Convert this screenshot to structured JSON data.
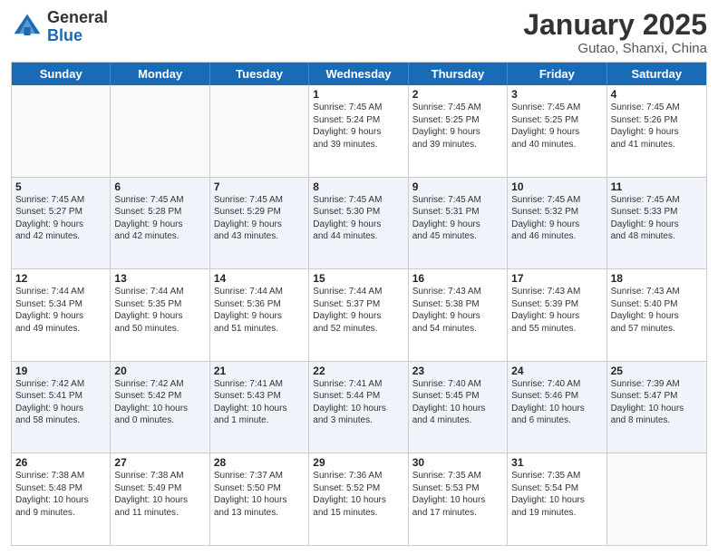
{
  "logo": {
    "general": "General",
    "blue": "Blue"
  },
  "title": "January 2025",
  "subtitle": "Gutao, Shanxi, China",
  "header_days": [
    "Sunday",
    "Monday",
    "Tuesday",
    "Wednesday",
    "Thursday",
    "Friday",
    "Saturday"
  ],
  "rows": [
    {
      "alt": false,
      "cells": [
        {
          "empty": true,
          "day": "",
          "detail": ""
        },
        {
          "empty": true,
          "day": "",
          "detail": ""
        },
        {
          "empty": true,
          "day": "",
          "detail": ""
        },
        {
          "empty": false,
          "day": "1",
          "detail": "Sunrise: 7:45 AM\nSunset: 5:24 PM\nDaylight: 9 hours\nand 39 minutes."
        },
        {
          "empty": false,
          "day": "2",
          "detail": "Sunrise: 7:45 AM\nSunset: 5:25 PM\nDaylight: 9 hours\nand 39 minutes."
        },
        {
          "empty": false,
          "day": "3",
          "detail": "Sunrise: 7:45 AM\nSunset: 5:25 PM\nDaylight: 9 hours\nand 40 minutes."
        },
        {
          "empty": false,
          "day": "4",
          "detail": "Sunrise: 7:45 AM\nSunset: 5:26 PM\nDaylight: 9 hours\nand 41 minutes."
        }
      ]
    },
    {
      "alt": true,
      "cells": [
        {
          "empty": false,
          "day": "5",
          "detail": "Sunrise: 7:45 AM\nSunset: 5:27 PM\nDaylight: 9 hours\nand 42 minutes."
        },
        {
          "empty": false,
          "day": "6",
          "detail": "Sunrise: 7:45 AM\nSunset: 5:28 PM\nDaylight: 9 hours\nand 42 minutes."
        },
        {
          "empty": false,
          "day": "7",
          "detail": "Sunrise: 7:45 AM\nSunset: 5:29 PM\nDaylight: 9 hours\nand 43 minutes."
        },
        {
          "empty": false,
          "day": "8",
          "detail": "Sunrise: 7:45 AM\nSunset: 5:30 PM\nDaylight: 9 hours\nand 44 minutes."
        },
        {
          "empty": false,
          "day": "9",
          "detail": "Sunrise: 7:45 AM\nSunset: 5:31 PM\nDaylight: 9 hours\nand 45 minutes."
        },
        {
          "empty": false,
          "day": "10",
          "detail": "Sunrise: 7:45 AM\nSunset: 5:32 PM\nDaylight: 9 hours\nand 46 minutes."
        },
        {
          "empty": false,
          "day": "11",
          "detail": "Sunrise: 7:45 AM\nSunset: 5:33 PM\nDaylight: 9 hours\nand 48 minutes."
        }
      ]
    },
    {
      "alt": false,
      "cells": [
        {
          "empty": false,
          "day": "12",
          "detail": "Sunrise: 7:44 AM\nSunset: 5:34 PM\nDaylight: 9 hours\nand 49 minutes."
        },
        {
          "empty": false,
          "day": "13",
          "detail": "Sunrise: 7:44 AM\nSunset: 5:35 PM\nDaylight: 9 hours\nand 50 minutes."
        },
        {
          "empty": false,
          "day": "14",
          "detail": "Sunrise: 7:44 AM\nSunset: 5:36 PM\nDaylight: 9 hours\nand 51 minutes."
        },
        {
          "empty": false,
          "day": "15",
          "detail": "Sunrise: 7:44 AM\nSunset: 5:37 PM\nDaylight: 9 hours\nand 52 minutes."
        },
        {
          "empty": false,
          "day": "16",
          "detail": "Sunrise: 7:43 AM\nSunset: 5:38 PM\nDaylight: 9 hours\nand 54 minutes."
        },
        {
          "empty": false,
          "day": "17",
          "detail": "Sunrise: 7:43 AM\nSunset: 5:39 PM\nDaylight: 9 hours\nand 55 minutes."
        },
        {
          "empty": false,
          "day": "18",
          "detail": "Sunrise: 7:43 AM\nSunset: 5:40 PM\nDaylight: 9 hours\nand 57 minutes."
        }
      ]
    },
    {
      "alt": true,
      "cells": [
        {
          "empty": false,
          "day": "19",
          "detail": "Sunrise: 7:42 AM\nSunset: 5:41 PM\nDaylight: 9 hours\nand 58 minutes."
        },
        {
          "empty": false,
          "day": "20",
          "detail": "Sunrise: 7:42 AM\nSunset: 5:42 PM\nDaylight: 10 hours\nand 0 minutes."
        },
        {
          "empty": false,
          "day": "21",
          "detail": "Sunrise: 7:41 AM\nSunset: 5:43 PM\nDaylight: 10 hours\nand 1 minute."
        },
        {
          "empty": false,
          "day": "22",
          "detail": "Sunrise: 7:41 AM\nSunset: 5:44 PM\nDaylight: 10 hours\nand 3 minutes."
        },
        {
          "empty": false,
          "day": "23",
          "detail": "Sunrise: 7:40 AM\nSunset: 5:45 PM\nDaylight: 10 hours\nand 4 minutes."
        },
        {
          "empty": false,
          "day": "24",
          "detail": "Sunrise: 7:40 AM\nSunset: 5:46 PM\nDaylight: 10 hours\nand 6 minutes."
        },
        {
          "empty": false,
          "day": "25",
          "detail": "Sunrise: 7:39 AM\nSunset: 5:47 PM\nDaylight: 10 hours\nand 8 minutes."
        }
      ]
    },
    {
      "alt": false,
      "cells": [
        {
          "empty": false,
          "day": "26",
          "detail": "Sunrise: 7:38 AM\nSunset: 5:48 PM\nDaylight: 10 hours\nand 9 minutes."
        },
        {
          "empty": false,
          "day": "27",
          "detail": "Sunrise: 7:38 AM\nSunset: 5:49 PM\nDaylight: 10 hours\nand 11 minutes."
        },
        {
          "empty": false,
          "day": "28",
          "detail": "Sunrise: 7:37 AM\nSunset: 5:50 PM\nDaylight: 10 hours\nand 13 minutes."
        },
        {
          "empty": false,
          "day": "29",
          "detail": "Sunrise: 7:36 AM\nSunset: 5:52 PM\nDaylight: 10 hours\nand 15 minutes."
        },
        {
          "empty": false,
          "day": "30",
          "detail": "Sunrise: 7:35 AM\nSunset: 5:53 PM\nDaylight: 10 hours\nand 17 minutes."
        },
        {
          "empty": false,
          "day": "31",
          "detail": "Sunrise: 7:35 AM\nSunset: 5:54 PM\nDaylight: 10 hours\nand 19 minutes."
        },
        {
          "empty": true,
          "day": "",
          "detail": ""
        }
      ]
    }
  ]
}
